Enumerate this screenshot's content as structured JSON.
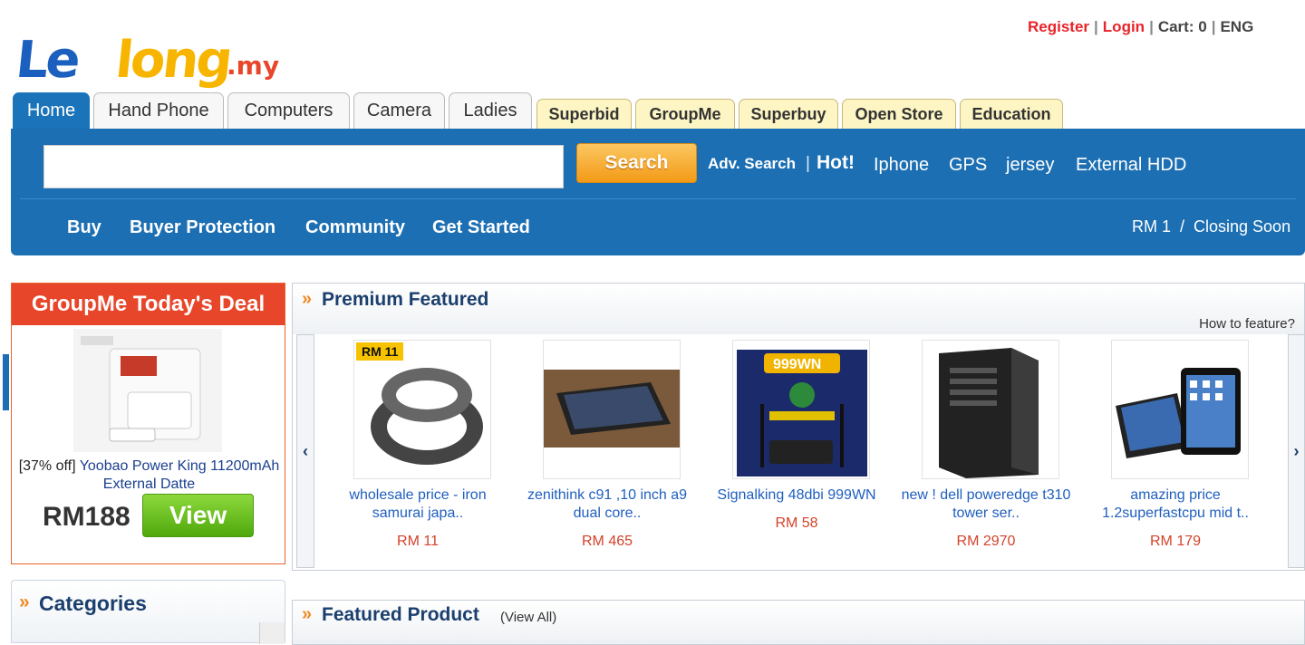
{
  "top_links": {
    "register": "Register",
    "login": "Login",
    "cart": "Cart: 0",
    "language": "ENG"
  },
  "logo": {
    "part1": "Le",
    "part2": "long",
    "part3": ".my"
  },
  "tabs": [
    {
      "label": "Home",
      "active": true
    },
    {
      "label": "Hand Phone"
    },
    {
      "label": "Computers"
    },
    {
      "label": "Camera"
    },
    {
      "label": "Ladies"
    },
    {
      "label": "Superbid"
    },
    {
      "label": "GroupMe"
    },
    {
      "label": "Superbuy"
    },
    {
      "label": "Open Store"
    },
    {
      "label": "Education"
    }
  ],
  "search": {
    "placeholder": "",
    "button_label": "Search",
    "advanced": "Adv. Search",
    "hot_label": "Hot!",
    "hot_items": [
      "Iphone",
      "GPS",
      "jersey",
      "External HDD"
    ]
  },
  "nav": {
    "items": [
      "Buy",
      "Buyer Protection",
      "Community",
      "Get Started"
    ],
    "right_text": "RM 1  /  Closing Soon"
  },
  "deal": {
    "header": "GroupMe Today's Deal",
    "discount": "[37% off]",
    "title": "Yoobao Power King 11200mAh External Datte",
    "price": "RM188",
    "button": "View"
  },
  "categories": {
    "title": "Categories"
  },
  "premium": {
    "title": "Premium Featured",
    "how_to": "How to feature?",
    "products": [
      {
        "title": "wholesale price - iron samurai japa..",
        "price": "RM 11",
        "badge": "RM 11"
      },
      {
        "title": "zenithink c91 ,10 inch a9 dual core..",
        "price": "RM 465"
      },
      {
        "title": "Signalking 48dbi 999WN",
        "price": "RM 58",
        "badge": "999WN"
      },
      {
        "title": "new ! dell poweredge t310 tower ser..",
        "price": "RM 2970"
      },
      {
        "title": "amazing price 1.2superfastcpu mid t..",
        "price": "RM 179"
      }
    ]
  },
  "featured": {
    "title": "Featured Product",
    "view_all": "(View All)"
  },
  "colors": {
    "brand_blue": "#1c6fb3",
    "accent_orange": "#f39a17",
    "deal_red": "#e8462a",
    "view_green": "#4fa80c",
    "price_red": "#d3432a"
  }
}
